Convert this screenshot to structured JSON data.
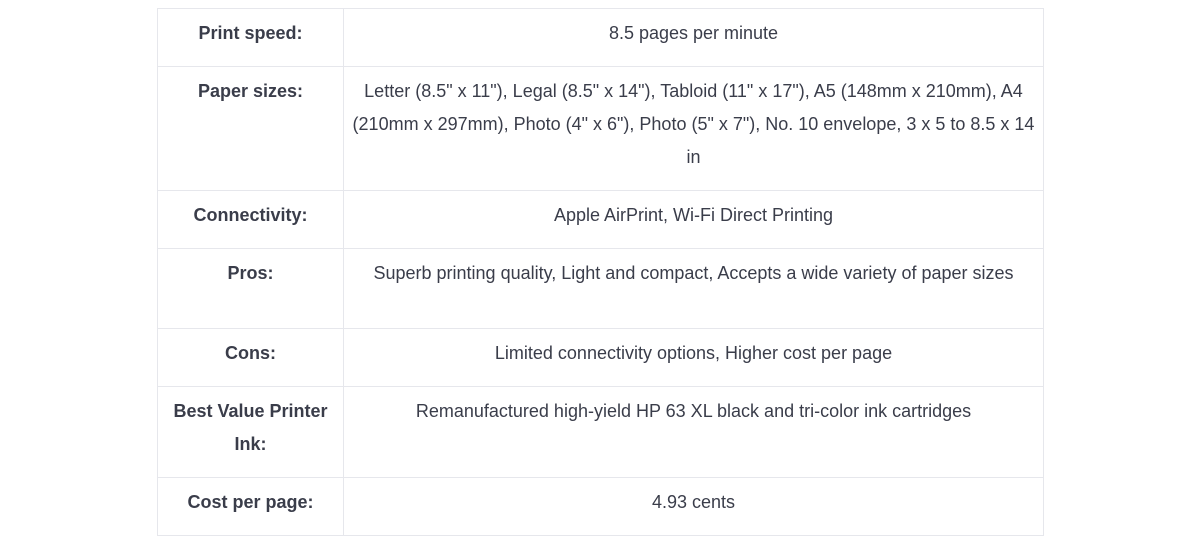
{
  "specs": [
    {
      "label": "Print speed:",
      "value": "8.5 pages per minute"
    },
    {
      "label": "Paper sizes:",
      "value": "Letter (8.5\" x 11\"), Legal (8.5\" x 14\"), Tabloid (11\" x 17\"), A5 (148mm x 210mm), A4 (210mm x 297mm), Photo (4\" x 6\"), Photo (5\" x 7\"), No. 10 envelope, 3 x 5 to 8.5 x 14 in"
    },
    {
      "label": "Connectivity:",
      "value": "Apple AirPrint, Wi-Fi Direct Printing"
    },
    {
      "label": "Pros:",
      "value": "Superb printing quality, Light and compact, Accepts a wide variety of paper sizes"
    },
    {
      "label": "Cons:",
      "value": "Limited connectivity options, Higher cost per page"
    },
    {
      "label": "Best Value Printer Ink:",
      "value": "Remanufactured high-yield HP 63 XL black and tri-color ink cartridges"
    },
    {
      "label": "Cost per page:",
      "value": "4.93 cents"
    }
  ]
}
